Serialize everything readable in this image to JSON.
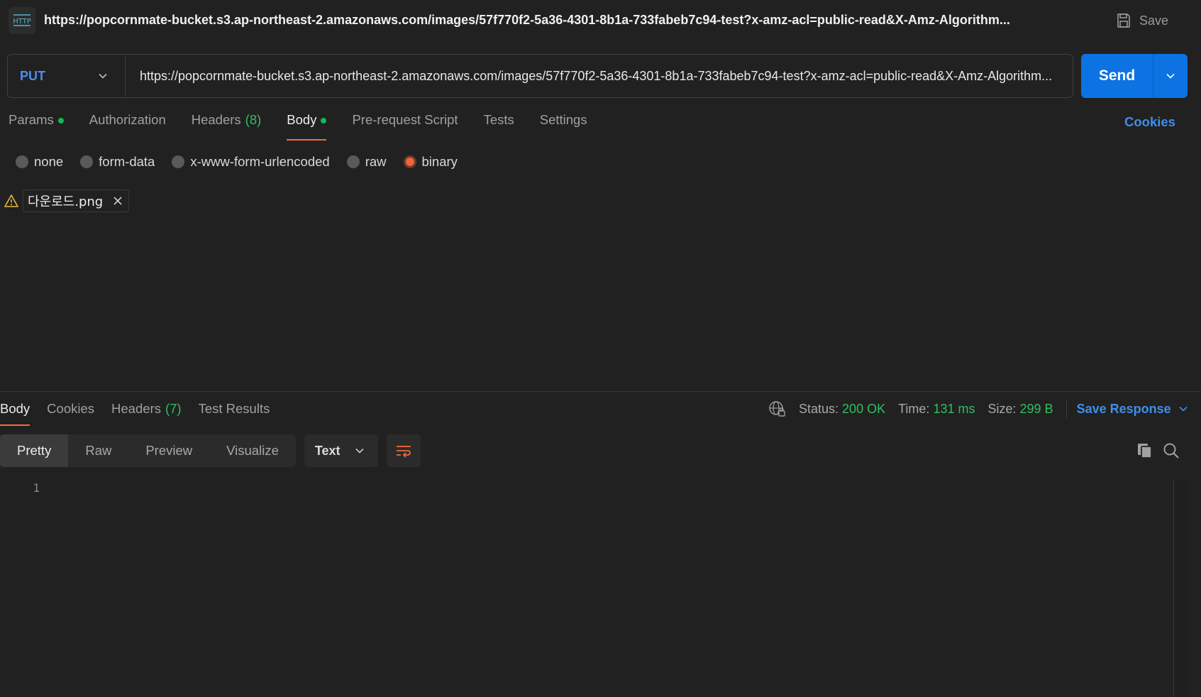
{
  "title": {
    "icon_label": "HTTP",
    "text": "https://popcornmate-bucket.s3.ap-northeast-2.amazonaws.com/images/57f770f2-5a36-4301-8b1a-733fabeb7c94-test?x-amz-acl=public-read&X-Amz-Algorithm...",
    "save_label": "Save"
  },
  "request": {
    "method": "PUT",
    "url": "https://popcornmate-bucket.s3.ap-northeast-2.amazonaws.com/images/57f770f2-5a36-4301-8b1a-733fabeb7c94-test?x-amz-acl=public-read&X-Amz-Algorithm...",
    "send_label": "Send"
  },
  "request_tabs": {
    "params": "Params",
    "authorization": "Authorization",
    "headers": "Headers",
    "headers_count": "(8)",
    "body": "Body",
    "prerequest": "Pre-request Script",
    "tests": "Tests",
    "settings": "Settings",
    "cookies": "Cookies"
  },
  "body_types": {
    "none": "none",
    "form_data": "form-data",
    "urlencoded": "x-www-form-urlencoded",
    "raw": "raw",
    "binary": "binary",
    "selected": "binary"
  },
  "file": {
    "name": "다운로드.png"
  },
  "response_tabs": {
    "body": "Body",
    "cookies": "Cookies",
    "headers": "Headers",
    "headers_count": "(7)",
    "test_results": "Test Results"
  },
  "response_meta": {
    "status_label": "Status:",
    "status_value": "200 OK",
    "time_label": "Time:",
    "time_value": "131 ms",
    "size_label": "Size:",
    "size_value": "299 B",
    "save_response": "Save Response"
  },
  "view": {
    "pretty": "Pretty",
    "raw": "Raw",
    "preview": "Preview",
    "visualize": "Visualize",
    "format": "Text"
  },
  "editor": {
    "line_1": "1"
  },
  "colors": {
    "accent_blue": "#0d73e3",
    "tab_underline": "#f26b3a",
    "success_green": "#2fbf5f",
    "link_blue": "#3f8fea",
    "warning": "#e8b83a"
  }
}
